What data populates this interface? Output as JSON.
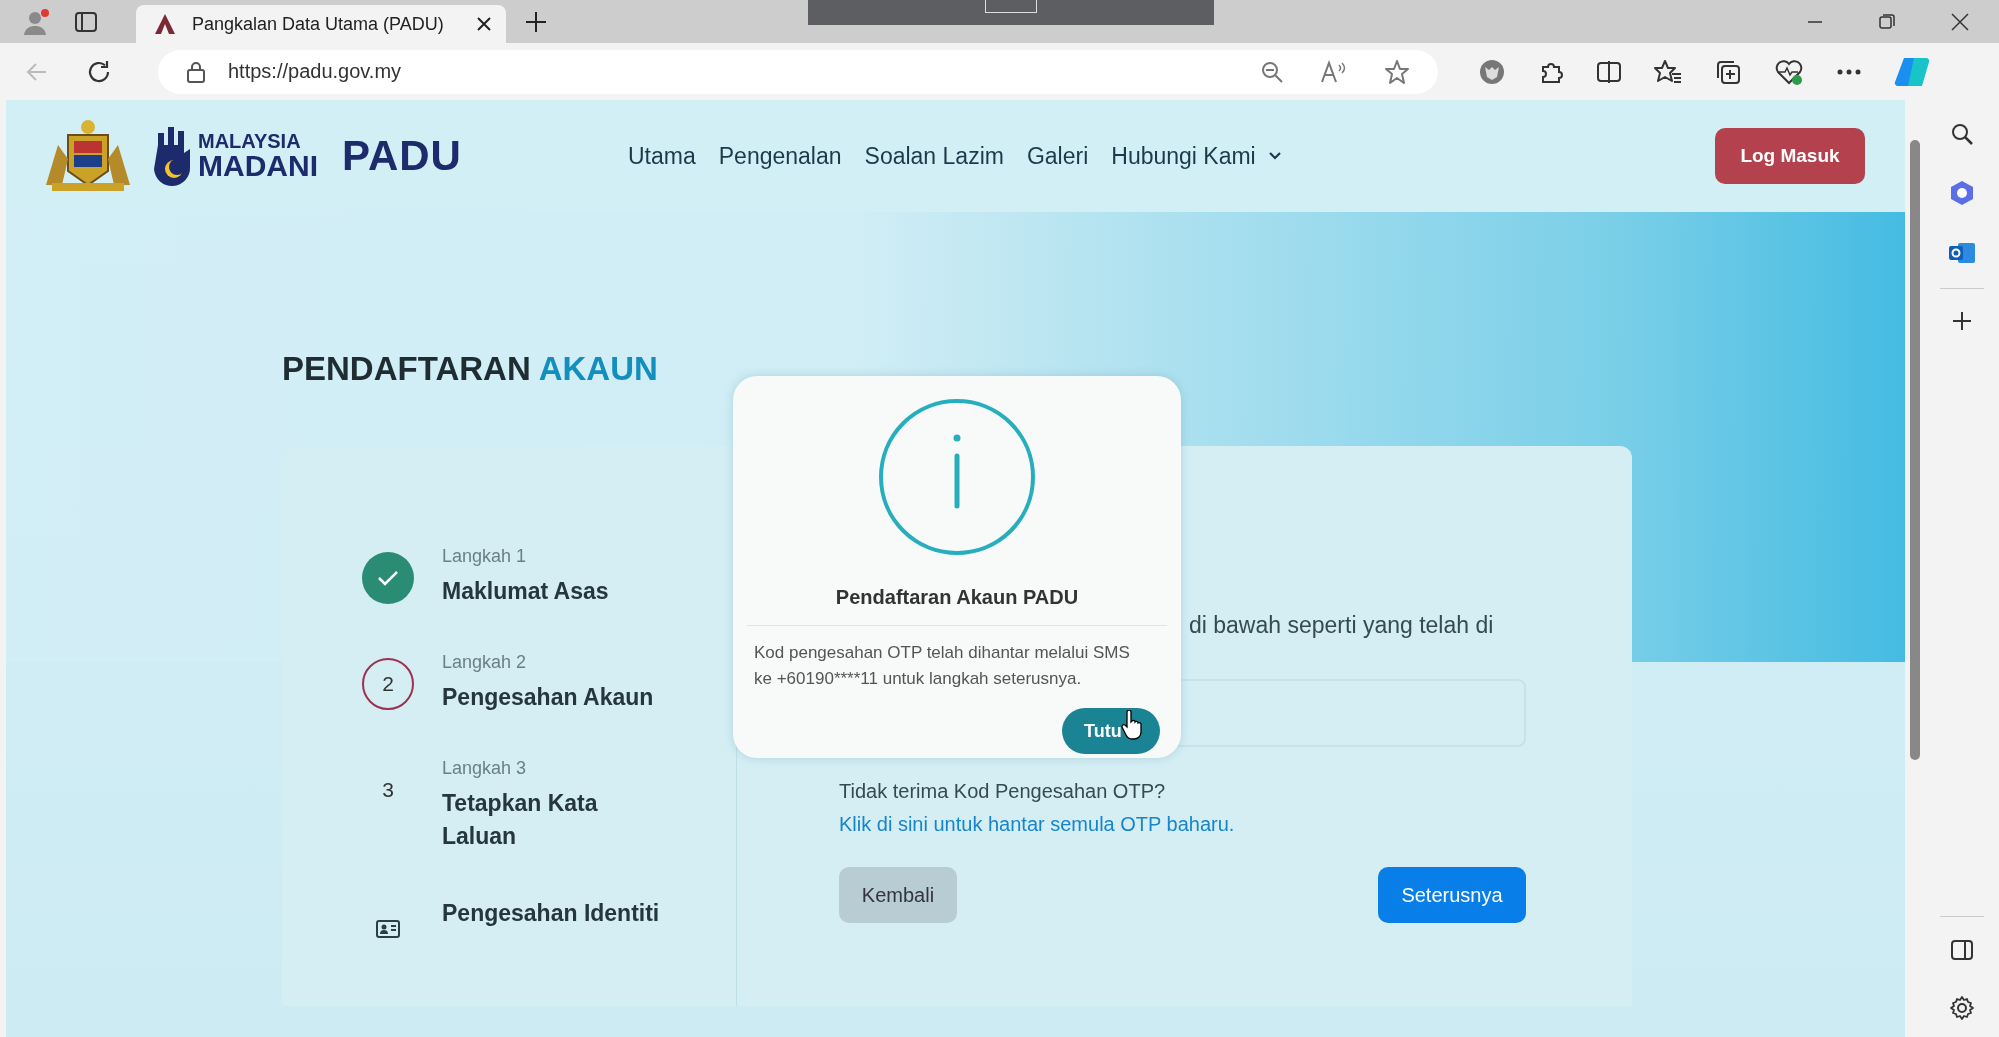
{
  "browser": {
    "tab_title": "Pangkalan Data Utama (PADU)",
    "url": "https://padu.gov.my"
  },
  "site_header": {
    "logo_texts": [
      "MALAYSIA",
      "MADANI"
    ],
    "brand": "PADU",
    "nav": [
      {
        "label": "Utama",
        "dropdown": false
      },
      {
        "label": "Pengenalan",
        "dropdown": false
      },
      {
        "label": "Soalan Lazim",
        "dropdown": false
      },
      {
        "label": "Galeri",
        "dropdown": false
      },
      {
        "label": "Hubungi Kami",
        "dropdown": true
      }
    ],
    "login_button": "Log Masuk"
  },
  "heading": {
    "main": "PENDAFTARAN",
    "accent": "AKAUN"
  },
  "steps": [
    {
      "kind": "check",
      "completed": true,
      "current": false,
      "label": "Langkah 1",
      "title": "Maklumat Asas"
    },
    {
      "kind": "number",
      "number": "2",
      "completed": false,
      "current": true,
      "label": "Langkah 2",
      "title": "Pengesahan Akaun"
    },
    {
      "kind": "number",
      "number": "3",
      "completed": false,
      "current": false,
      "label": "Langkah 3",
      "title": "Tetapkan Kata Laluan"
    },
    {
      "kind": "id-card",
      "completed": false,
      "current": false,
      "title": "Pengesahan Identiti"
    }
  ],
  "form": {
    "instruction": "di bawah seperti yang telah di",
    "resend_text": "Tidak terima Kod Pengesahan OTP?",
    "resend_link": "Klik di sini untuk hantar semula OTP baharu.",
    "back_button": "Kembali",
    "next_button": "Seterusnya"
  },
  "dialog": {
    "title": "Pendaftaran Akaun PADU",
    "message": "Kod pengesahan OTP telah dihantar melalui SMS ke +60190****11 untuk langkah seterusnya.",
    "button": "Tutu"
  }
}
